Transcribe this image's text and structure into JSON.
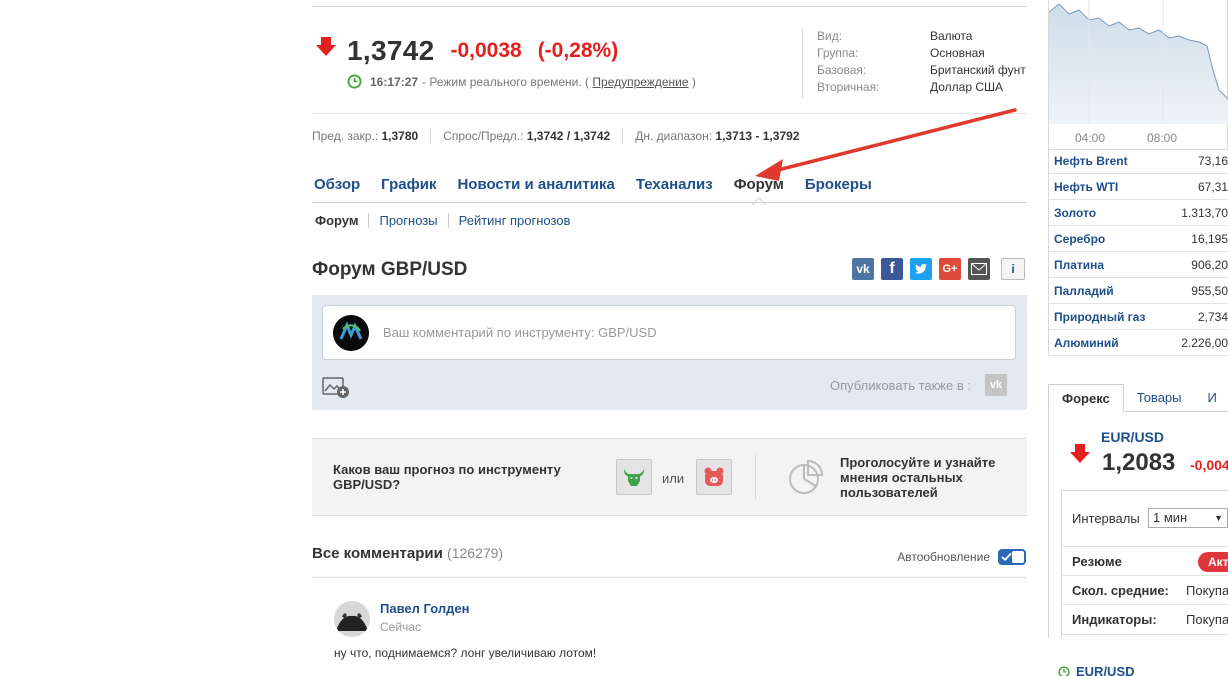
{
  "quote": {
    "last": "1,3742",
    "change": "-0,0038",
    "change_pct": "(-0,28%)",
    "time": "16:17:27",
    "realtime_text": "- Режим реального времени. (",
    "warning_link": "Предупреждение",
    "paren_close": ")",
    "colors": {
      "down": "#e4201f",
      "link": "#1e4f8c",
      "clock": "#4aa843"
    }
  },
  "info": [
    {
      "k": "Вид:",
      "v": "Валюта"
    },
    {
      "k": "Группа:",
      "v": "Основная"
    },
    {
      "k": "Базовая:",
      "v": "Британский фунт"
    },
    {
      "k": "Вторичная:",
      "v": "Доллар США"
    }
  ],
  "stats": {
    "prev_close_label": "Пред. закр.:",
    "prev_close": "1,3780",
    "bid_ask_label": "Спрос/Предл.:",
    "bid_ask": "1,3742 / 1,3742",
    "range_label": "Дн. диапазон:",
    "range": "1,3713 - 1,3792"
  },
  "tabs": [
    "Обзор",
    "График",
    "Новости и аналитика",
    "Теханализ",
    "Форум",
    "Брокеры"
  ],
  "subtabs": [
    "Форум",
    "Прогнозы",
    "Рейтинг прогнозов"
  ],
  "forum": {
    "title": "Форум GBP/USD",
    "share": {
      "vk": "vk",
      "fb": "f",
      "gp": "G+",
      "info": "i"
    },
    "comment_placeholder": "Ваш комментарий по инструменту: GBP/USD",
    "publish_also": "Опубликовать также в :",
    "poll_question": "Каков ваш прогноз по инструменту GBP/USD?",
    "poll_or": "или",
    "poll_vote_text": "Проголосуйте и узнайте мнения остальных пользователей",
    "all_comments": "Все комментарии",
    "comment_count": "(126279)",
    "autoupdate": "Автообновление",
    "comment": {
      "author": "Павел Голден",
      "time": "Сейчас",
      "text": "ну что, поднимаемся? лонг увеличиваю лотом!"
    }
  },
  "sidebar": {
    "chart_labels": [
      "04:00",
      "08:00"
    ],
    "commodities": [
      {
        "name": "Нефть Brent",
        "price": "73,16"
      },
      {
        "name": "Нефть WTI",
        "price": "67,31"
      },
      {
        "name": "Золото",
        "price": "1.313,70"
      },
      {
        "name": "Серебро",
        "price": "16,195"
      },
      {
        "name": "Платина",
        "price": "906,20"
      },
      {
        "name": "Палладий",
        "price": "955,50"
      },
      {
        "name": "Природный газ",
        "price": "2,734"
      },
      {
        "name": "Алюминий",
        "price": "2.226,00"
      }
    ],
    "tabs": [
      "Форекс",
      "Товары",
      "И"
    ],
    "fx": {
      "name": "EUR/USD",
      "price": "1,2083",
      "change": "-0,004"
    },
    "ta": {
      "intervals_label": "Интервалы",
      "interval": "1 мин",
      "summary_label": "Резюме",
      "summary_badge": "Акт",
      "ma_label": "Скол. средние:",
      "ma_value": "Покупа",
      "ind_label": "Индикаторы:",
      "ind_value": "Покупа"
    },
    "fx_bottom": "EUR/USD"
  }
}
